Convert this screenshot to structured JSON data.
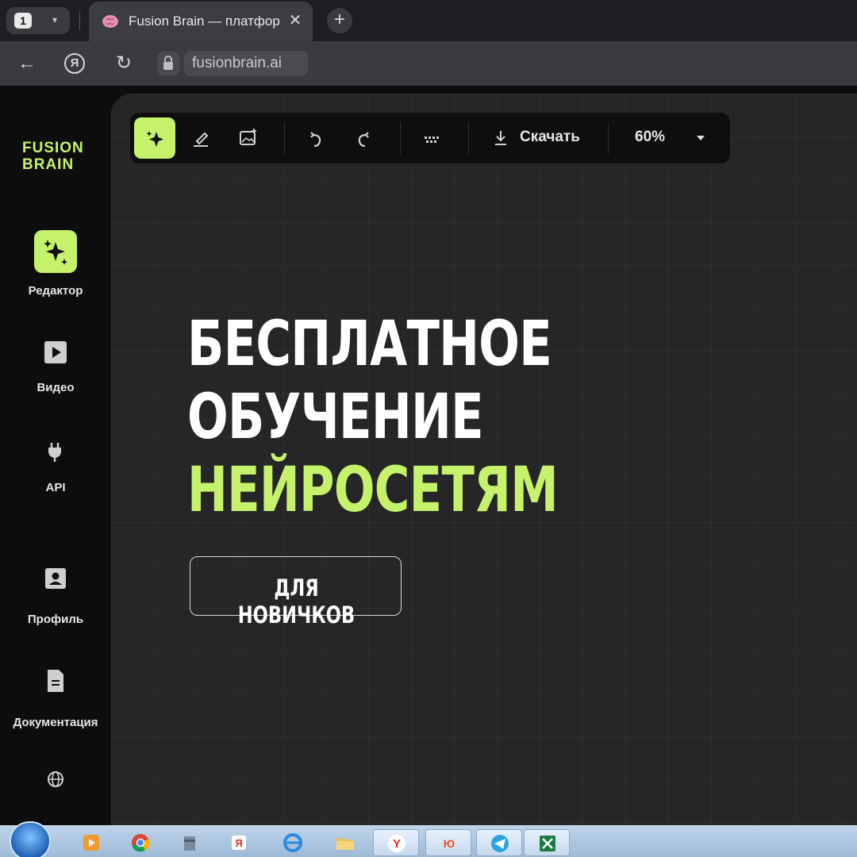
{
  "browser": {
    "tab_count": "1",
    "tab_title": "Fusion Brain — платфор",
    "close_symbol": "✕",
    "new_tab_symbol": "+",
    "url": "fusionbrain.ai"
  },
  "app": {
    "logo": [
      "FUSION",
      "BRAIN"
    ],
    "accent_color": "#c5f26a",
    "sidebar": [
      {
        "label": "Редактор",
        "icon": "sparkle-icon"
      },
      {
        "label": "Видео",
        "icon": "video-play-icon"
      },
      {
        "label": "API",
        "icon": "plug-icon"
      },
      {
        "label": "Профиль",
        "icon": "profile-card-icon"
      },
      {
        "label": "Документация",
        "icon": "document-icon"
      },
      {
        "label": "",
        "icon": "globe-icon"
      }
    ],
    "toolbar": {
      "download_label": "Скачать",
      "zoom": "60%"
    }
  },
  "promo": {
    "headline": [
      "БЕСПЛАТНОЕ",
      "ОБУЧЕНИЕ",
      "НЕЙРОСЕТЯМ"
    ],
    "button": "ДЛЯ НОВИЧКОВ"
  }
}
